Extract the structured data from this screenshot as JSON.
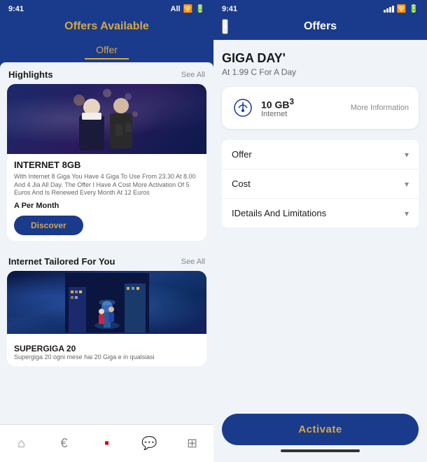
{
  "left": {
    "status_bar": {
      "time": "9:41",
      "carrier": "All",
      "signal": "▲▼",
      "wifi": "📶",
      "battery": "🔋"
    },
    "header_title": "Offers Available",
    "tabs": [
      {
        "label": "Offer",
        "active": true
      }
    ],
    "highlights_label": "Highlights",
    "see_all_label": "See All",
    "card1": {
      "title": "INTERNET 8GB",
      "description": "With Internet 8 Giga You Have 4 Giga To Use From 23.30 At 8.00 And 4 Jia All Day. The Offer I Have A Cost More Activation Of 5 Euros And Is Renewed Every Month At 12 Euros",
      "price": "A Per Month",
      "discover_label": "Discover"
    },
    "section2_label": "Internet Tailored For You",
    "see_all2_label": "See All",
    "card2": {
      "title": "SUPERGIGA 20",
      "description": "Supergiga 20 ogni mese hai 20 Giga e in qualsiasi"
    },
    "nav": {
      "home": "⌂",
      "euro": "€",
      "sim": "▪",
      "chat": "💬",
      "grid": "⊞"
    }
  },
  "right": {
    "status_bar": {
      "time": "9:41",
      "signal": "||||",
      "wifi": "📶",
      "battery": "🔋"
    },
    "back_label": "‹",
    "header_title": "Offers",
    "offer_title": "GIGA DAY'",
    "offer_subtitle": "At 1.99 C For A Day",
    "offer_card": {
      "gb_label": "10 GB",
      "superscript": "3",
      "type_label": "Internet",
      "more_info_label": "More Information"
    },
    "accordion": [
      {
        "label": "Offer"
      },
      {
        "label": "Cost"
      },
      {
        "label": "IDetails And Limitations"
      }
    ],
    "activate_label": "Activate"
  }
}
